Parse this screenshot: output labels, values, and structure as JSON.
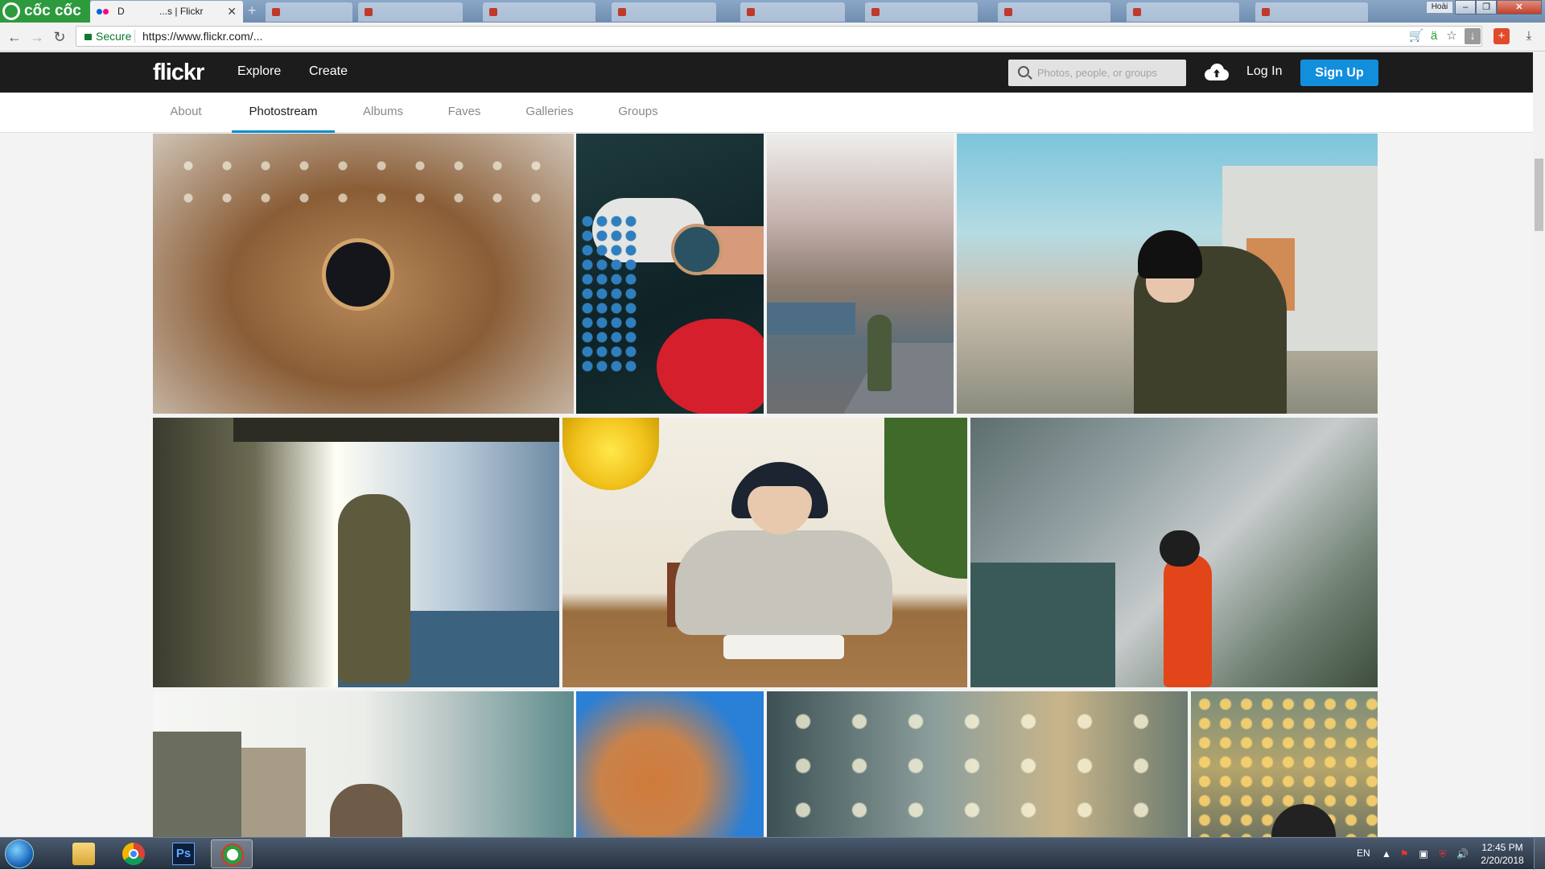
{
  "browser": {
    "brand": "cốc cốc",
    "active_tab_title": "Flickr",
    "active_tab_prefix": "D",
    "active_tab_middle": "...s |",
    "new_tab_glyph": "+",
    "user_badge": "Hoài",
    "secure_label": "Secure",
    "url": "https://www.flickr.com/..."
  },
  "flickr": {
    "logo": "flickr",
    "nav": {
      "explore": "Explore",
      "create": "Create"
    },
    "search_placeholder": "Photos, people, or groups",
    "login": "Log In",
    "signup": "Sign Up",
    "tabs": [
      "About",
      "Photostream",
      "Albums",
      "Faves",
      "Galleries",
      "Groups"
    ],
    "active_tab": "Photostream"
  },
  "photos": [
    "watch on wooden table with fairy lights",
    "wrist wearing watch with blue and red flowers",
    "girl standing in narrow street with blossoms",
    "girl leaning on railing by old buildings",
    "girl in sunlight under garage roof",
    "girl reading book under yellow lamp",
    "girl in orange jacket by greenhouse",
    "girl by buildings in bright sunlight",
    "orange autumn tree against blue sky",
    "bokeh lights behind window",
    "girl with golden bokeh lights"
  ],
  "taskbar": {
    "language": "EN",
    "time": "12:45 PM",
    "date": "2/20/2018",
    "apps": [
      "file-explorer",
      "chrome",
      "photoshop",
      "coccoc"
    ],
    "photoshop_label": "Ps"
  }
}
